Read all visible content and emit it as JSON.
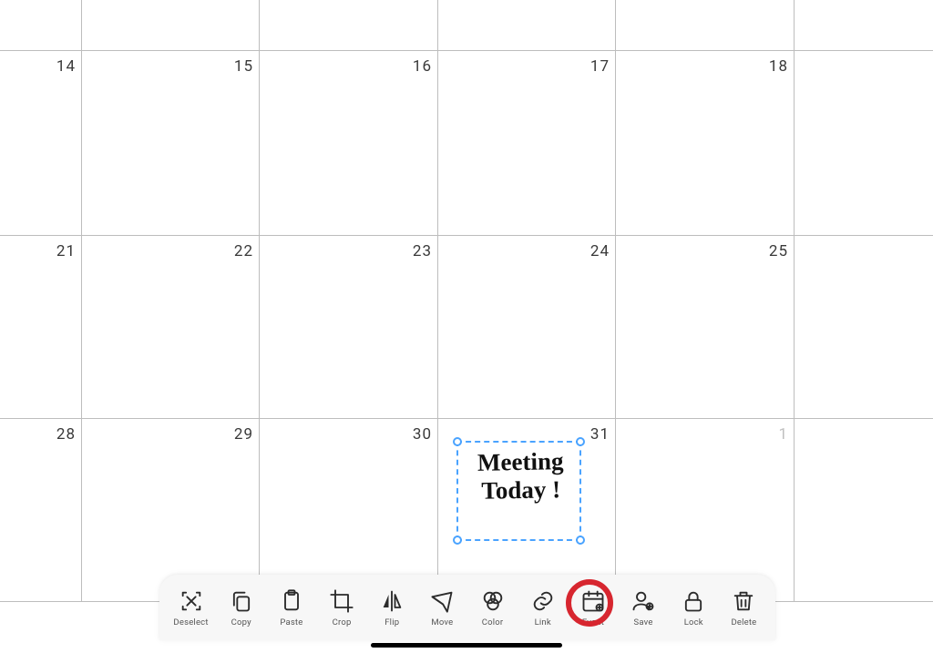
{
  "calendar": {
    "rows": [
      {
        "dates": [
          "14",
          "15",
          "16",
          "17",
          "18"
        ]
      },
      {
        "dates": [
          "21",
          "22",
          "23",
          "24",
          "25"
        ]
      },
      {
        "dates": [
          "28",
          "29",
          "30",
          "31",
          "1"
        ],
        "faded_indices": [
          4
        ]
      }
    ],
    "handwriting_line1": "Meeting",
    "handwriting_line2": "Today !"
  },
  "toolbar": {
    "deselect": "Deselect",
    "copy": "Copy",
    "paste": "Paste",
    "crop": "Crop",
    "flip": "Flip",
    "move": "Move",
    "color": "Color",
    "link": "Link",
    "event": "Event",
    "save": "Save",
    "lock": "Lock",
    "delete": "Delete"
  },
  "annotation": {
    "highlighted_tool": "event"
  }
}
